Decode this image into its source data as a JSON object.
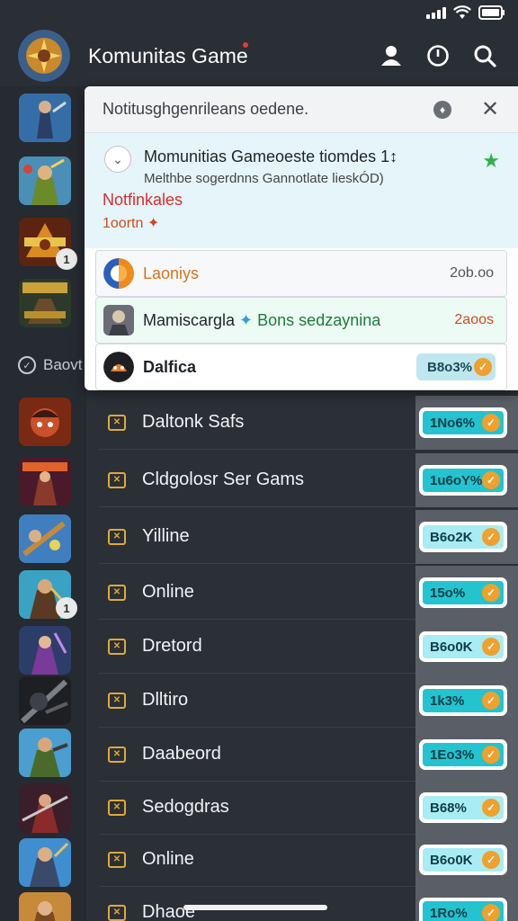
{
  "header": {
    "title": "Komunitas Game",
    "icons": [
      "profile-icon",
      "clock-icon",
      "search-icon"
    ]
  },
  "sidebar": {
    "section_label": "Baovt",
    "badges": [
      "1",
      "1"
    ]
  },
  "notification_panel": {
    "title": "Notitusghgenrileans oedene.",
    "info_icon": "info-icon",
    "close_label": "✕",
    "message": {
      "title": "Momunitias Gameoeste tiomdes 1↕",
      "subtitle": "Melthbe sogerdnns Gannotlate lieskÓD)",
      "label": "Notfinkales",
      "sub_label": "1oortn ✦"
    },
    "items": [
      {
        "label": "Laoniys",
        "value": "2ob.oo",
        "label_color": "#d9731c",
        "value_color": "#555555"
      },
      {
        "label": "Mamiscargla",
        "extra": "Bons sedzaynina",
        "value": "2aoos",
        "label_color": "#1f2329",
        "value_color": "#d14a1e"
      },
      {
        "label": "Dalfica",
        "chip": "B8o3%"
      }
    ]
  },
  "games": [
    {
      "label": "Daltonk Safs",
      "chip": "1No6%",
      "style": "dark"
    },
    {
      "label": "Cldgolosr Ser Gams",
      "chip": "1u6oY%",
      "style": "dark"
    },
    {
      "label": "Yilline",
      "chip": "B6o2K",
      "style": "light"
    },
    {
      "label": "Online",
      "chip": "15o%",
      "style": "dark"
    },
    {
      "label": "Dretord",
      "chip": "B6o0K",
      "style": "light"
    },
    {
      "label": "Dlltiro",
      "chip": "1k3%",
      "style": "dark"
    },
    {
      "label": "Daabeord",
      "chip": "1Eo3%",
      "style": "dark"
    },
    {
      "label": "Sedogdras",
      "chip": "B68%",
      "style": "light"
    },
    {
      "label": "Online",
      "chip": "B6o0K",
      "style": "light"
    },
    {
      "label": "Dhaoe",
      "chip": "1Ro%",
      "style": "dark"
    }
  ],
  "colors": {
    "accent_teal": "#23c3cf",
    "coin_orange": "#f0a02c",
    "alert_red": "#d92c2c",
    "star_green": "#2fb24b"
  }
}
